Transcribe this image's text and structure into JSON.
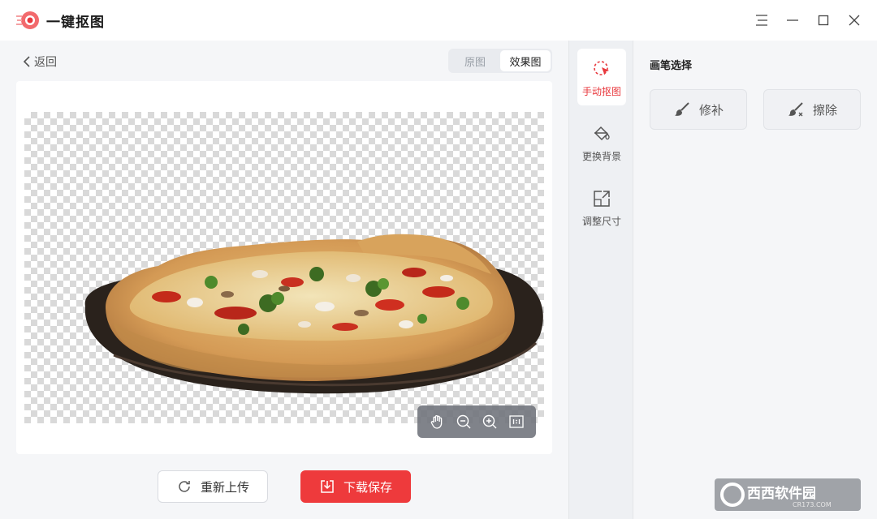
{
  "app": {
    "title": "一键抠图"
  },
  "window_controls": [
    "menu-icon",
    "minimize-icon",
    "maximize-icon",
    "close-icon"
  ],
  "nav": {
    "back_label": "返回"
  },
  "view_toggle": {
    "options": [
      "原图",
      "效果图"
    ],
    "active": "效果图"
  },
  "canvas": {
    "image": "pizza cutout on transparent background"
  },
  "zoom_tools": [
    "hand-icon",
    "zoom-out-icon",
    "zoom-in-icon",
    "actual-size-icon"
  ],
  "actions": {
    "reupload_label": "重新上传",
    "download_label": "下载保存"
  },
  "tools": [
    {
      "label": "手动抠图",
      "icon": "manual-cutout-icon",
      "active": true
    },
    {
      "label": "更换背景",
      "icon": "paint-bucket-icon",
      "active": false
    },
    {
      "label": "调整尺寸",
      "icon": "resize-icon",
      "active": false
    }
  ],
  "brush_panel": {
    "title": "画笔选择",
    "repair_label": "修补",
    "erase_label": "擦除"
  },
  "watermark": {
    "text": "西西软件园",
    "subtext": "CR173.COM"
  },
  "colors": {
    "accent": "#ee3a3c",
    "rail": "#eef0f3",
    "panel": "#f5f6f8"
  }
}
